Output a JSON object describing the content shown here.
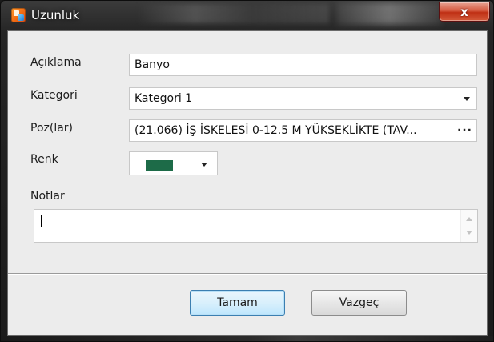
{
  "window": {
    "title": "Uzunluk",
    "close_glyph": "x",
    "icon": "app-logo-icon"
  },
  "form": {
    "aciklama": {
      "label": "Açıklama",
      "value": "Banyo"
    },
    "kategori": {
      "label": "Kategori",
      "value": "Kategori 1"
    },
    "pozlar": {
      "label": "Poz(lar)",
      "value": "(21.066) İŞ İSKELESİ 0-12.5 M YÜKSEKLİKTE (TAV...",
      "more_glyph": "···"
    },
    "renk": {
      "label": "Renk",
      "color": "#1d6b48"
    },
    "notlar": {
      "label": "Notlar",
      "value": ""
    }
  },
  "buttons": {
    "ok": "Tamam",
    "cancel": "Vazgeç"
  }
}
